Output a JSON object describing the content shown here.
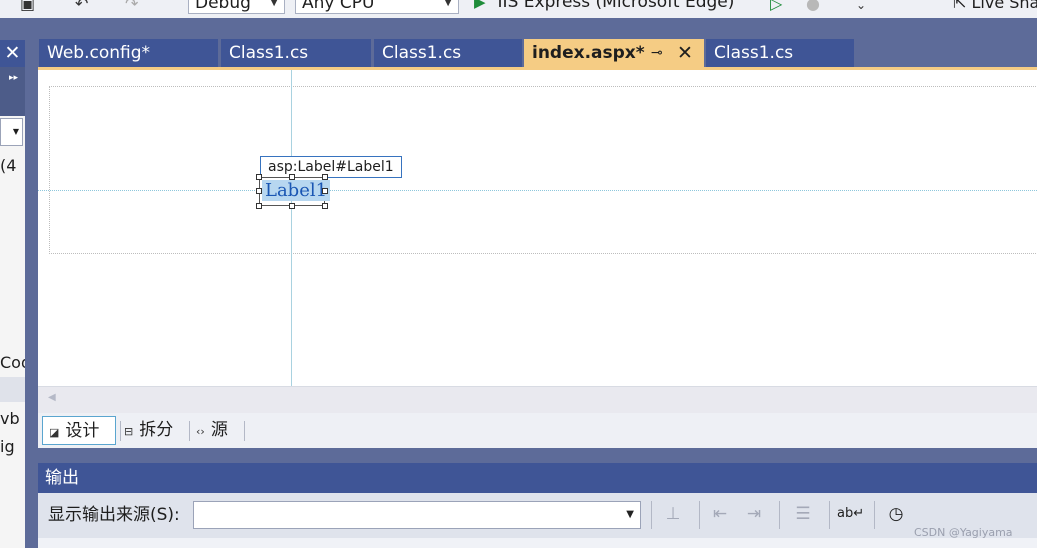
{
  "toolbar": {
    "config": "Debug",
    "platform": "Any CPU",
    "run_target": "IIS Express (Microsoft Edge)",
    "live_share": "Live Share"
  },
  "left_panel": {
    "close_glyph": "✕",
    "text_1": "(4",
    "text_2": "Cod",
    "text_3": "vb",
    "text_4": "ig"
  },
  "tabs": [
    {
      "label": "Web.config*"
    },
    {
      "label": "Class1.cs"
    },
    {
      "label": "Class1.cs"
    },
    {
      "label": "index.aspx*",
      "active": true
    },
    {
      "label": "Class1.cs"
    }
  ],
  "designer": {
    "label_tag": "asp:Label#Label1",
    "label_text": "Label1"
  },
  "view_tabs": [
    {
      "label": "设计",
      "selected": true
    },
    {
      "label": "拆分"
    },
    {
      "label": "源"
    }
  ],
  "output": {
    "title": "输出",
    "show_source_label": "显示输出来源(S):",
    "source_value": ""
  },
  "watermark": "CSDN @Yagiyama",
  "colors": {
    "tab_bg": "#3f5596",
    "active_tab": "#f5cc84",
    "frame": "#5d6b99",
    "label_selection": "#b7d7f0"
  }
}
